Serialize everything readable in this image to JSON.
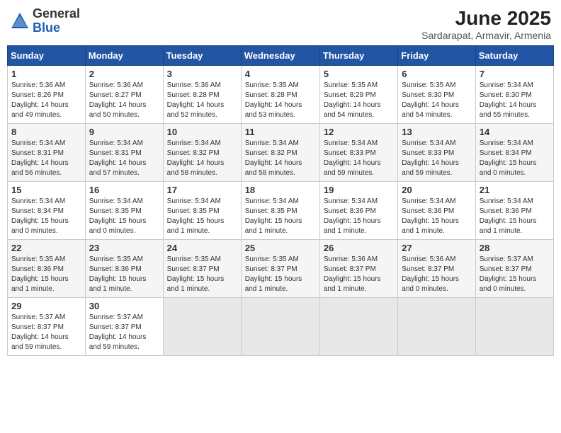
{
  "header": {
    "logo_line1": "General",
    "logo_line2": "Blue",
    "month_year": "June 2025",
    "location": "Sardarapat, Armavir, Armenia"
  },
  "weekdays": [
    "Sunday",
    "Monday",
    "Tuesday",
    "Wednesday",
    "Thursday",
    "Friday",
    "Saturday"
  ],
  "weeks": [
    [
      {
        "day": "1",
        "info": "Sunrise: 5:36 AM\nSunset: 8:26 PM\nDaylight: 14 hours\nand 49 minutes."
      },
      {
        "day": "2",
        "info": "Sunrise: 5:36 AM\nSunset: 8:27 PM\nDaylight: 14 hours\nand 50 minutes."
      },
      {
        "day": "3",
        "info": "Sunrise: 5:36 AM\nSunset: 8:28 PM\nDaylight: 14 hours\nand 52 minutes."
      },
      {
        "day": "4",
        "info": "Sunrise: 5:35 AM\nSunset: 8:28 PM\nDaylight: 14 hours\nand 53 minutes."
      },
      {
        "day": "5",
        "info": "Sunrise: 5:35 AM\nSunset: 8:29 PM\nDaylight: 14 hours\nand 54 minutes."
      },
      {
        "day": "6",
        "info": "Sunrise: 5:35 AM\nSunset: 8:30 PM\nDaylight: 14 hours\nand 54 minutes."
      },
      {
        "day": "7",
        "info": "Sunrise: 5:34 AM\nSunset: 8:30 PM\nDaylight: 14 hours\nand 55 minutes."
      }
    ],
    [
      {
        "day": "8",
        "info": "Sunrise: 5:34 AM\nSunset: 8:31 PM\nDaylight: 14 hours\nand 56 minutes."
      },
      {
        "day": "9",
        "info": "Sunrise: 5:34 AM\nSunset: 8:31 PM\nDaylight: 14 hours\nand 57 minutes."
      },
      {
        "day": "10",
        "info": "Sunrise: 5:34 AM\nSunset: 8:32 PM\nDaylight: 14 hours\nand 58 minutes."
      },
      {
        "day": "11",
        "info": "Sunrise: 5:34 AM\nSunset: 8:32 PM\nDaylight: 14 hours\nand 58 minutes."
      },
      {
        "day": "12",
        "info": "Sunrise: 5:34 AM\nSunset: 8:33 PM\nDaylight: 14 hours\nand 59 minutes."
      },
      {
        "day": "13",
        "info": "Sunrise: 5:34 AM\nSunset: 8:33 PM\nDaylight: 14 hours\nand 59 minutes."
      },
      {
        "day": "14",
        "info": "Sunrise: 5:34 AM\nSunset: 8:34 PM\nDaylight: 15 hours\nand 0 minutes."
      }
    ],
    [
      {
        "day": "15",
        "info": "Sunrise: 5:34 AM\nSunset: 8:34 PM\nDaylight: 15 hours\nand 0 minutes."
      },
      {
        "day": "16",
        "info": "Sunrise: 5:34 AM\nSunset: 8:35 PM\nDaylight: 15 hours\nand 0 minutes."
      },
      {
        "day": "17",
        "info": "Sunrise: 5:34 AM\nSunset: 8:35 PM\nDaylight: 15 hours\nand 1 minute."
      },
      {
        "day": "18",
        "info": "Sunrise: 5:34 AM\nSunset: 8:35 PM\nDaylight: 15 hours\nand 1 minute."
      },
      {
        "day": "19",
        "info": "Sunrise: 5:34 AM\nSunset: 8:36 PM\nDaylight: 15 hours\nand 1 minute."
      },
      {
        "day": "20",
        "info": "Sunrise: 5:34 AM\nSunset: 8:36 PM\nDaylight: 15 hours\nand 1 minute."
      },
      {
        "day": "21",
        "info": "Sunrise: 5:34 AM\nSunset: 8:36 PM\nDaylight: 15 hours\nand 1 minute."
      }
    ],
    [
      {
        "day": "22",
        "info": "Sunrise: 5:35 AM\nSunset: 8:36 PM\nDaylight: 15 hours\nand 1 minute."
      },
      {
        "day": "23",
        "info": "Sunrise: 5:35 AM\nSunset: 8:36 PM\nDaylight: 15 hours\nand 1 minute."
      },
      {
        "day": "24",
        "info": "Sunrise: 5:35 AM\nSunset: 8:37 PM\nDaylight: 15 hours\nand 1 minute."
      },
      {
        "day": "25",
        "info": "Sunrise: 5:35 AM\nSunset: 8:37 PM\nDaylight: 15 hours\nand 1 minute."
      },
      {
        "day": "26",
        "info": "Sunrise: 5:36 AM\nSunset: 8:37 PM\nDaylight: 15 hours\nand 1 minute."
      },
      {
        "day": "27",
        "info": "Sunrise: 5:36 AM\nSunset: 8:37 PM\nDaylight: 15 hours\nand 0 minutes."
      },
      {
        "day": "28",
        "info": "Sunrise: 5:37 AM\nSunset: 8:37 PM\nDaylight: 15 hours\nand 0 minutes."
      }
    ],
    [
      {
        "day": "29",
        "info": "Sunrise: 5:37 AM\nSunset: 8:37 PM\nDaylight: 14 hours\nand 59 minutes."
      },
      {
        "day": "30",
        "info": "Sunrise: 5:37 AM\nSunset: 8:37 PM\nDaylight: 14 hours\nand 59 minutes."
      },
      {
        "day": "",
        "info": ""
      },
      {
        "day": "",
        "info": ""
      },
      {
        "day": "",
        "info": ""
      },
      {
        "day": "",
        "info": ""
      },
      {
        "day": "",
        "info": ""
      }
    ]
  ]
}
